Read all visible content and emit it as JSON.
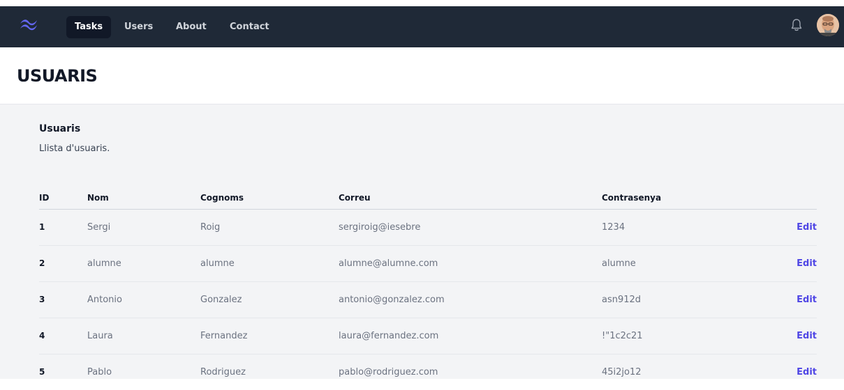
{
  "nav": {
    "links": [
      "Tasks",
      "Users",
      "About",
      "Contact"
    ],
    "active": "Tasks",
    "logo_icon": "tailwind-logo-icon",
    "bell_icon": "bell-icon"
  },
  "header": {
    "title": "USUARIS"
  },
  "section": {
    "title": "Usuaris",
    "description": "Llista d'usuaris."
  },
  "table": {
    "columns": [
      "ID",
      "Nom",
      "Cognoms",
      "Correu",
      "Contrasenya"
    ],
    "edit_label": "Edit",
    "rows": [
      {
        "id": "1",
        "nom": "Sergi",
        "cognoms": "Roig",
        "correu": "sergiroig@iesebre",
        "contrasenya": "1234"
      },
      {
        "id": "2",
        "nom": "alumne",
        "cognoms": "alumne",
        "correu": "alumne@alumne.com",
        "contrasenya": "alumne"
      },
      {
        "id": "3",
        "nom": "Antonio",
        "cognoms": "Gonzalez",
        "correu": "antonio@gonzalez.com",
        "contrasenya": "asn912d"
      },
      {
        "id": "4",
        "nom": "Laura",
        "cognoms": "Fernandez",
        "correu": "laura@fernandez.com",
        "contrasenya": "!\"1c2c21"
      },
      {
        "id": "5",
        "nom": "Pablo",
        "cognoms": "Rodriguez",
        "correu": "pablo@rodriguez.com",
        "contrasenya": "45i2jo12"
      }
    ]
  },
  "colors": {
    "nav_bg": "#1f2937",
    "accent": "#4f46e5",
    "logo": "#6366f1"
  }
}
